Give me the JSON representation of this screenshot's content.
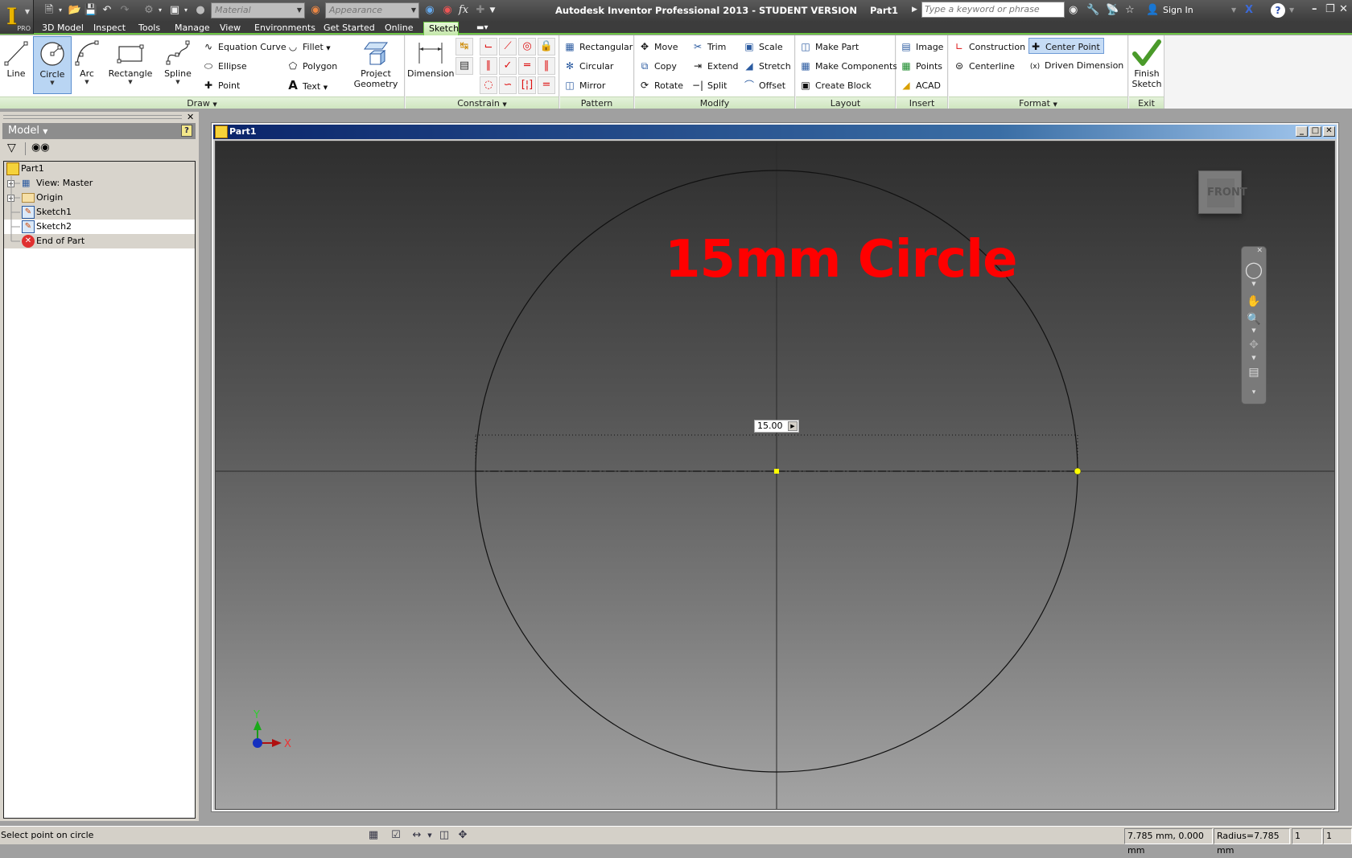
{
  "app": {
    "title": "Autodesk Inventor Professional 2013 - STUDENT VERSION",
    "document": "Part1",
    "logo_letter": "I",
    "edition": "PRO"
  },
  "quick_access": {
    "material_placeholder": "Material",
    "appearance_placeholder": "Appearance",
    "fx_label": "fx"
  },
  "infocenter": {
    "search_placeholder": "Type a keyword or phrase",
    "sign_in": "Sign In",
    "help": "?"
  },
  "menu_tabs": [
    {
      "label": "3D Model",
      "active": false
    },
    {
      "label": "Inspect",
      "active": false
    },
    {
      "label": "Tools",
      "active": false
    },
    {
      "label": "Manage",
      "active": false
    },
    {
      "label": "View",
      "active": false
    },
    {
      "label": "Environments",
      "active": false
    },
    {
      "label": "Get Started",
      "active": false
    },
    {
      "label": "Online",
      "active": false
    },
    {
      "label": "Sketch",
      "active": true
    }
  ],
  "ribbon": {
    "draw": {
      "label": "Draw",
      "line": "Line",
      "circle": "Circle",
      "arc": "Arc",
      "rectangle": "Rectangle",
      "spline": "Spline",
      "equation_curve": "Equation Curve",
      "ellipse": "Ellipse",
      "point": "Point",
      "fillet": "Fillet",
      "polygon": "Polygon",
      "text": "Text",
      "project_geometry_1": "Project",
      "project_geometry_2": "Geometry"
    },
    "constrain": {
      "label": "Constrain",
      "dimension": "Dimension"
    },
    "pattern": {
      "label": "Pattern",
      "rectangular": "Rectangular",
      "circular": "Circular",
      "mirror": "Mirror"
    },
    "modify": {
      "label": "Modify",
      "move": "Move",
      "copy": "Copy",
      "rotate": "Rotate",
      "trim": "Trim",
      "extend": "Extend",
      "split": "Split",
      "scale": "Scale",
      "stretch": "Stretch",
      "offset": "Offset"
    },
    "layout": {
      "label": "Layout",
      "make_part": "Make Part",
      "make_components": "Make Components",
      "create_block": "Create Block"
    },
    "insert": {
      "label": "Insert",
      "image": "Image",
      "points": "Points",
      "acad": "ACAD"
    },
    "format": {
      "label": "Format",
      "construction": "Construction",
      "centerline": "Centerline",
      "center_point": "Center Point",
      "driven_dimension": "Driven Dimension"
    },
    "exit": {
      "label": "Exit",
      "finish_1": "Finish",
      "finish_2": "Sketch"
    }
  },
  "browser": {
    "header": "Model",
    "help": "?",
    "tree": [
      {
        "label": "Part1",
        "icon": "part-icon",
        "level": 0,
        "expandable": false,
        "selected": false
      },
      {
        "label": "View: Master",
        "icon": "view-rep-icon",
        "level": 1,
        "expandable": true,
        "selected": false
      },
      {
        "label": "Origin",
        "icon": "folder-icon",
        "level": 1,
        "expandable": true,
        "selected": false
      },
      {
        "label": "Sketch1",
        "icon": "sketch-icon",
        "level": 1,
        "expandable": false,
        "selected": false
      },
      {
        "label": "Sketch2",
        "icon": "sketch-icon",
        "level": 1,
        "expandable": false,
        "selected": true
      },
      {
        "label": "End of Part",
        "icon": "end-of-part-icon",
        "level": 1,
        "expandable": false,
        "selected": false
      }
    ]
  },
  "document_window": {
    "title": "Part1",
    "annotation": "15mm Circle",
    "dimension_input": "15.00",
    "viewcube_face": "FRONT",
    "triad": {
      "x": "X",
      "y": "Y"
    }
  },
  "sketch": {
    "circle_diameter_mm": 15.0,
    "accent_color": "#ff0000",
    "point_color": "#ffff00"
  },
  "status": {
    "prompt": "Select point on circle",
    "coordinates": "7.785 mm, 0.000 mm",
    "radius": "Radius=7.785 mm",
    "count1": "1",
    "count2": "1"
  }
}
